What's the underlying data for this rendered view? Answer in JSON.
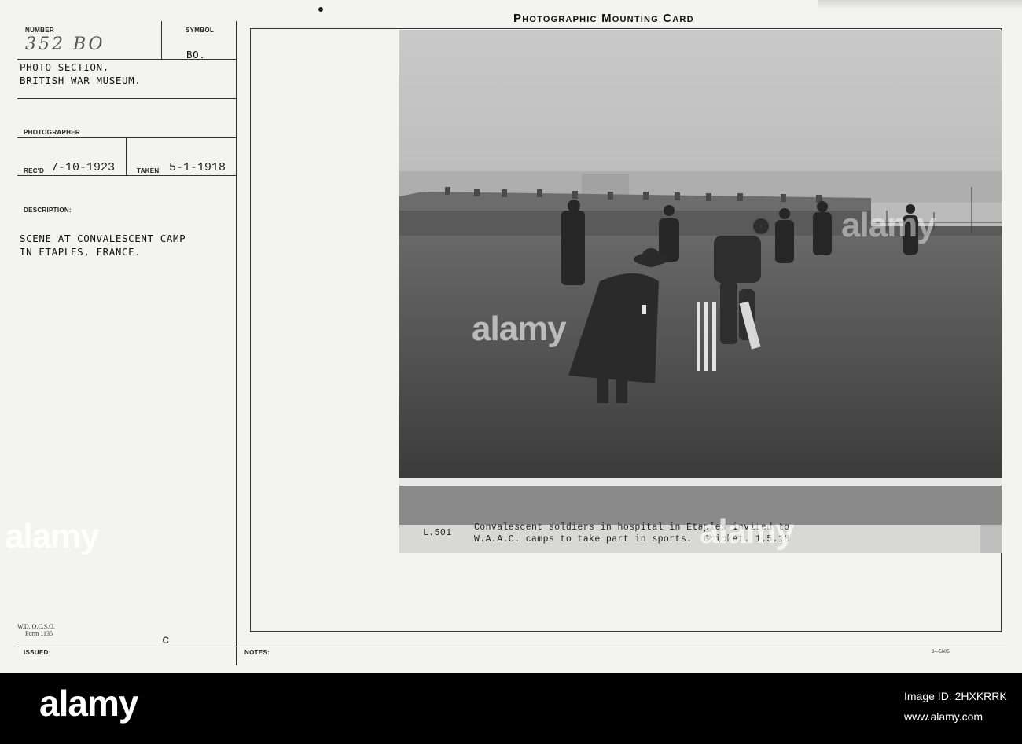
{
  "card": {
    "title": "Photographic Mounting Card",
    "number_label": "NUMBER",
    "number_value": "352 BO",
    "symbol_label": "SYMBOL",
    "symbol_value": "BO.",
    "section_line1": "PHOTO SECTION,",
    "section_line2": "BRITISH WAR MUSEUM.",
    "photographer_label": "PHOTOGRAPHER",
    "recd_label": "REC'D",
    "recd_value": "7-10-1923",
    "taken_label": "TAKEN",
    "taken_value": "5-1-1918",
    "description_label": "DESCRIPTION:",
    "description_line1": "SCENE AT CONVALESCENT CAMP",
    "description_line2": "IN ETAPLES, FRANCE.",
    "form_line1": "W.D.,O.C.S.O.",
    "form_line2": "Form 1135",
    "issued_label": "ISSUED:",
    "issued_mark": "c",
    "notes_label": "NOTES:",
    "print_code": "3—5605"
  },
  "photo": {
    "caption_id": "L.501",
    "caption_line1": "Convalescent soldiers in hospital in Etaples invited to",
    "caption_line2": "W.A.A.C. camps to take part in sports.  Cricket. 1.5.18"
  },
  "watermark": {
    "logo": "alamy",
    "image_id_label": "Image ID: 2HXKRRK",
    "url": "www.alamy.com"
  }
}
